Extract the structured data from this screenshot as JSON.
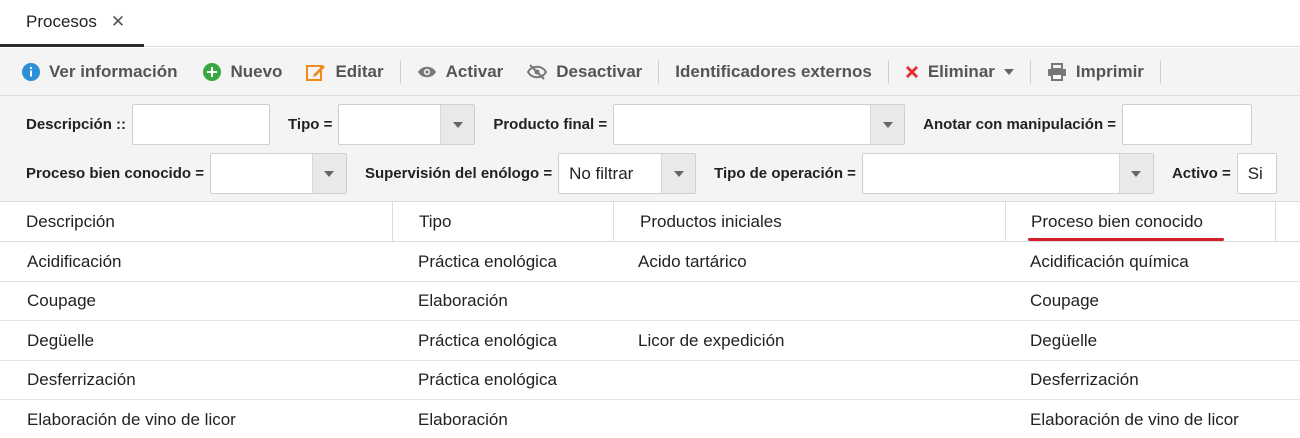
{
  "tab": {
    "label": "Procesos",
    "close": "✕"
  },
  "toolbar": {
    "info_label": "Ver información",
    "new_label": "Nuevo",
    "edit_label": "Editar",
    "activate_label": "Activar",
    "deactivate_label": "Desactivar",
    "external_ids_label": "Identificadores externos",
    "delete_label": "Eliminar",
    "print_label": "Imprimir"
  },
  "filters": {
    "descripcion": {
      "label": "Descripción ::",
      "value": ""
    },
    "tipo": {
      "label": "Tipo =",
      "value": ""
    },
    "producto_final": {
      "label": "Producto final =",
      "value": ""
    },
    "anotar": {
      "label": "Anotar con manipulación =",
      "value": ""
    },
    "proceso_conocido": {
      "label": "Proceso bien conocido =",
      "value": ""
    },
    "supervision": {
      "label": "Supervisión del enólogo =",
      "value": "No filtrar"
    },
    "tipo_operacion": {
      "label": "Tipo de operación =",
      "value": ""
    },
    "activo": {
      "label": "Activo =",
      "value": "Si"
    }
  },
  "grid": {
    "columns": [
      "Descripción",
      "Tipo",
      "Productos iniciales",
      "Proceso bien conocido"
    ],
    "sorted_column": "Proceso bien conocido",
    "rows": [
      [
        "Acidificación",
        "Práctica enológica",
        "Acido tartárico",
        "Acidificación química"
      ],
      [
        "Coupage",
        "Elaboración",
        "",
        "Coupage"
      ],
      [
        "Degüelle",
        "Práctica enológica",
        "Licor de expedición",
        "Degüelle"
      ],
      [
        "Desferrización",
        "Práctica enológica",
        "",
        "Desferrización"
      ],
      [
        "Elaboración de vino de licor",
        "Elaboración",
        "",
        "Elaboración de vino de licor"
      ]
    ]
  },
  "colors": {
    "accent_red": "#d21f2a",
    "info_blue": "#2d8fd5",
    "new_green": "#3aa745",
    "edit_orange": "#f08a1c",
    "delete_red": "#e0303b"
  }
}
